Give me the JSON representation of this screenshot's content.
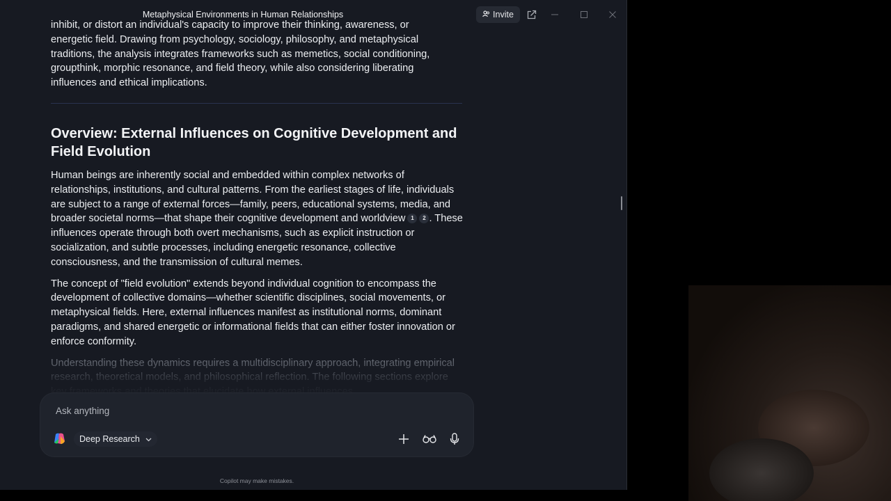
{
  "window": {
    "title": "Metaphysical Environments in Human Relationships",
    "invite_label": "Invite",
    "icons": [
      "people-icon",
      "pop-out-icon",
      "minimize-icon",
      "maximize-icon",
      "close-icon"
    ]
  },
  "article": {
    "intro_lines": [
      "inhibit, or distort an individual's capacity to improve their thinking, awareness, or",
      "energetic field. Drawing from psychology, sociology, philosophy, and metaphysical",
      "traditions, the analysis integrates frameworks such as memetics, social conditioning,",
      "groupthink, morphic resonance, and field theory, while also considering liberating",
      "influences and ethical implications."
    ],
    "heading": "Overview: External Influences on Cognitive Development and Field Evolution",
    "para1_before": "Human beings are inherently social and embedded within complex networks of relationships, institutions, and cultural patterns. From the earliest stages of life, individuals are subject to a range of external forces—family, peers, educational systems, media, and broader societal norms—that shape their cognitive development and worldview",
    "para1_cite1": "1",
    "para1_cite2": "2",
    "para1_after": ". These influences operate through both overt mechanisms, such as explicit instruction or socialization, and subtle processes, including energetic resonance, collective consciousness, and the transmission of cultural memes.",
    "para2": "The concept of \"field evolution\" extends beyond individual cognition to encompass the development of collective domains—whether scientific disciplines, social movements, or metaphysical fields. Here, external influences manifest as institutional norms, dominant paradigms, and shared energetic or informational fields that can either foster innovation or enforce conformity.",
    "para3": "Understanding these dynamics requires a multidisciplinary approach, integrating empirical research, theoretical models, and philosophical reflection. The following sections explore key frameworks and theories that elucidate how external influences"
  },
  "composer": {
    "placeholder": "Ask anything",
    "mode_label": "Deep Research",
    "icons": [
      "copilot-logo-icon",
      "chevron-down-icon",
      "plus-icon",
      "glasses-icon",
      "microphone-icon"
    ]
  },
  "footer": {
    "disclaimer": "Copilot may make mistakes."
  }
}
